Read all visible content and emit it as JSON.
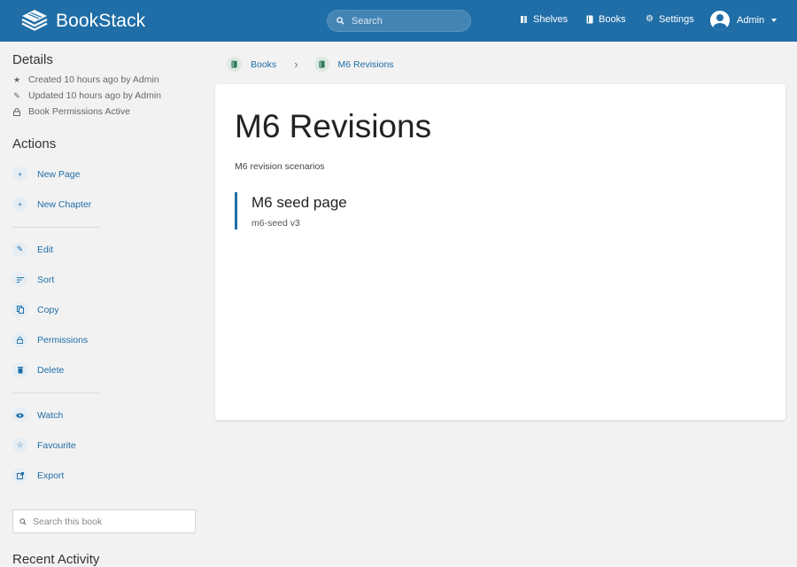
{
  "app": {
    "name": "BookStack"
  },
  "header": {
    "search_placeholder": "Search",
    "nav": {
      "shelves": "Shelves",
      "books": "Books",
      "settings": "Settings"
    },
    "user": {
      "name": "Admin"
    }
  },
  "sidebar": {
    "details": {
      "title": "Details",
      "created": "Created 10 hours ago by Admin",
      "updated": "Updated 10 hours ago by Admin",
      "permissions": "Book Permissions Active"
    },
    "actions": {
      "title": "Actions",
      "new_page": "New Page",
      "new_chapter": "New Chapter",
      "edit": "Edit",
      "sort": "Sort",
      "copy": "Copy",
      "permissions": "Permissions",
      "delete": "Delete",
      "watch": "Watch",
      "favourite": "Favourite",
      "export": "Export"
    },
    "book_search_placeholder": "Search this book",
    "recent_activity_title": "Recent Activity"
  },
  "breadcrumb": {
    "books": "Books",
    "current": "M6 Revisions"
  },
  "book": {
    "title": "M6 Revisions",
    "description": "M6 revision scenarios",
    "pages": [
      {
        "name": "M6 seed page",
        "excerpt": "m6-seed v3"
      }
    ]
  },
  "colors": {
    "header": "#206ea7",
    "link": "#206ea7",
    "background": "#f2f2f2"
  }
}
